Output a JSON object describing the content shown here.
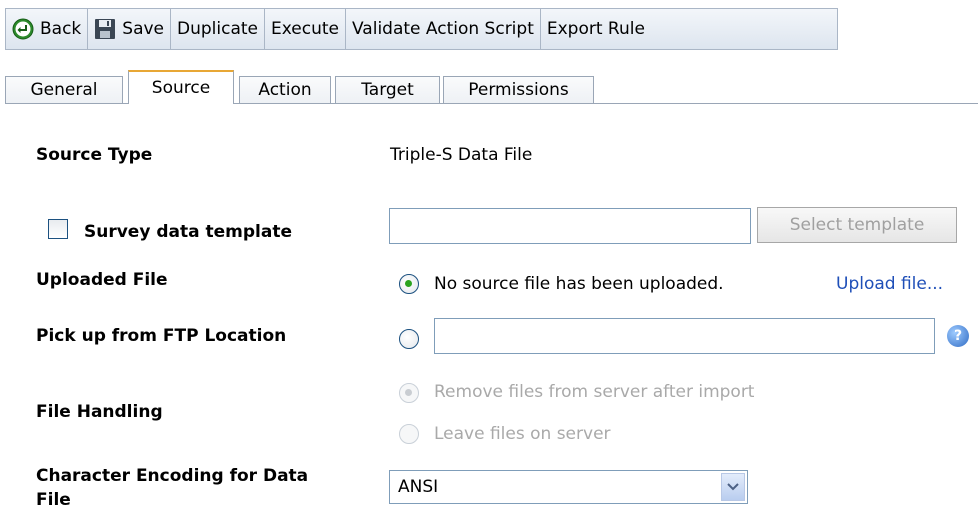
{
  "toolbar": {
    "back": "Back",
    "save": "Save",
    "duplicate": "Duplicate",
    "execute": "Execute",
    "validate": "Validate Action Script",
    "export": "Export Rule"
  },
  "tabs": [
    "General",
    "Source",
    "Action",
    "Target",
    "Permissions"
  ],
  "active_tab": "Source",
  "form": {
    "source_type_label": "Source Type",
    "source_type_value": "Triple-S Data File",
    "survey_template_label": "Survey data template",
    "survey_template_value": "",
    "select_template_button": "Select template",
    "uploaded_file_label": "Uploaded File",
    "uploaded_file_text": "No source file has been uploaded.",
    "upload_link": "Upload file...",
    "ftp_label": "Pick up from FTP Location",
    "ftp_value": "",
    "help_glyph": "?",
    "file_handling_label": "File Handling",
    "remove_files_option": "Remove files from server after import",
    "leave_files_option": "Leave files on server",
    "encoding_label_line1": "Character Encoding for Data",
    "encoding_label_line2": "File",
    "encoding_value": "ANSI"
  },
  "colors": {
    "link": "#1f4fb8",
    "active_tab_accent": "#e8a735",
    "radio_selected": "#2aa31e"
  }
}
